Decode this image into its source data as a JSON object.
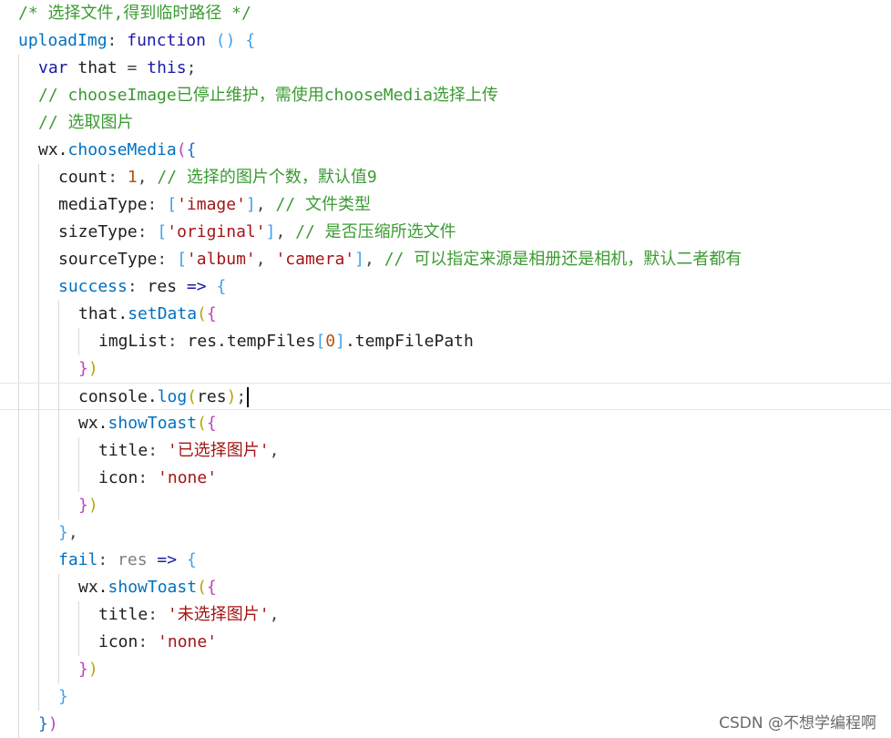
{
  "editor": {
    "lines": [
      {
        "indent": 0,
        "tokens": [
          [
            "comment",
            "/* 选择文件,得到临时路径 */"
          ]
        ]
      },
      {
        "indent": 0,
        "tokens": [
          [
            "propfn",
            "uploadImg"
          ],
          [
            "punct",
            ": "
          ],
          [
            "keyword",
            "function"
          ],
          [
            "plain",
            " "
          ],
          [
            "b3",
            "()"
          ],
          [
            "plain",
            " "
          ],
          [
            "b3",
            "{"
          ]
        ]
      },
      {
        "indent": 1,
        "tokens": [
          [
            "keyword",
            "var"
          ],
          [
            "plain",
            " that "
          ],
          [
            "punct",
            "= "
          ],
          [
            "keyword",
            "this"
          ],
          [
            "punct",
            ";"
          ]
        ]
      },
      {
        "indent": 1,
        "tokens": [
          [
            "comment",
            "// chooseImage已停止维护，需使用chooseMedia选择上传"
          ]
        ]
      },
      {
        "indent": 1,
        "tokens": [
          [
            "comment",
            "// 选取图片"
          ]
        ]
      },
      {
        "indent": 1,
        "tokens": [
          [
            "plain",
            "wx."
          ],
          [
            "propfn",
            "chooseMedia"
          ],
          [
            "b2",
            "("
          ],
          [
            "b1",
            "{"
          ]
        ]
      },
      {
        "indent": 2,
        "tokens": [
          [
            "prop",
            "count"
          ],
          [
            "punct",
            ": "
          ],
          [
            "num",
            "1"
          ],
          [
            "punct",
            ", "
          ],
          [
            "comment",
            "// 选择的图片个数，默认值9"
          ]
        ]
      },
      {
        "indent": 2,
        "tokens": [
          [
            "prop",
            "mediaType"
          ],
          [
            "punct",
            ": "
          ],
          [
            "b3",
            "["
          ],
          [
            "str",
            "'image'"
          ],
          [
            "b3",
            "]"
          ],
          [
            "punct",
            ", "
          ],
          [
            "comment",
            "// 文件类型"
          ]
        ]
      },
      {
        "indent": 2,
        "tokens": [
          [
            "prop",
            "sizeType"
          ],
          [
            "punct",
            ": "
          ],
          [
            "b3",
            "["
          ],
          [
            "str",
            "'original'"
          ],
          [
            "b3",
            "]"
          ],
          [
            "punct",
            ", "
          ],
          [
            "comment",
            "// 是否压缩所选文件"
          ]
        ]
      },
      {
        "indent": 2,
        "tokens": [
          [
            "prop",
            "sourceType"
          ],
          [
            "punct",
            ": "
          ],
          [
            "b3",
            "["
          ],
          [
            "str",
            "'album'"
          ],
          [
            "punct",
            ", "
          ],
          [
            "str",
            "'camera'"
          ],
          [
            "b3",
            "]"
          ],
          [
            "punct",
            ", "
          ],
          [
            "comment",
            "// 可以指定来源是相册还是相机，默认二者都有"
          ]
        ]
      },
      {
        "indent": 2,
        "tokens": [
          [
            "propfn",
            "success"
          ],
          [
            "punct",
            ": "
          ],
          [
            "plain",
            "res "
          ],
          [
            "keyword",
            "=>"
          ],
          [
            "plain",
            " "
          ],
          [
            "b3",
            "{"
          ]
        ]
      },
      {
        "indent": 3,
        "tokens": [
          [
            "plain",
            "that."
          ],
          [
            "propfn",
            "setData"
          ],
          [
            "b4",
            "("
          ],
          [
            "b2",
            "{"
          ]
        ]
      },
      {
        "indent": 4,
        "tokens": [
          [
            "prop",
            "imgList"
          ],
          [
            "punct",
            ": "
          ],
          [
            "plain",
            "res.tempFiles"
          ],
          [
            "b3",
            "["
          ],
          [
            "num",
            "0"
          ],
          [
            "b3",
            "]"
          ],
          [
            "plain",
            ".tempFilePath"
          ]
        ]
      },
      {
        "indent": 3,
        "tokens": [
          [
            "b2",
            "}"
          ],
          [
            "b4",
            ")"
          ]
        ]
      },
      {
        "indent": 3,
        "current": true,
        "tokens": [
          [
            "plain",
            "console."
          ],
          [
            "propfn",
            "log"
          ],
          [
            "b4",
            "("
          ],
          [
            "plain",
            "res"
          ],
          [
            "b4",
            ")"
          ],
          [
            "punct",
            ";"
          ]
        ]
      },
      {
        "indent": 3,
        "tokens": [
          [
            "plain",
            "wx."
          ],
          [
            "propfn",
            "showToast"
          ],
          [
            "b4",
            "("
          ],
          [
            "b2",
            "{"
          ]
        ]
      },
      {
        "indent": 4,
        "tokens": [
          [
            "prop",
            "title"
          ],
          [
            "punct",
            ": "
          ],
          [
            "str",
            "'已选择图片'"
          ],
          [
            "punct",
            ","
          ]
        ]
      },
      {
        "indent": 4,
        "tokens": [
          [
            "prop",
            "icon"
          ],
          [
            "punct",
            ": "
          ],
          [
            "str",
            "'none'"
          ]
        ]
      },
      {
        "indent": 3,
        "tokens": [
          [
            "b2",
            "}"
          ],
          [
            "b4",
            ")"
          ]
        ]
      },
      {
        "indent": 2,
        "tokens": [
          [
            "b3",
            "}"
          ],
          [
            "punct",
            ","
          ]
        ]
      },
      {
        "indent": 2,
        "tokens": [
          [
            "propfn",
            "fail"
          ],
          [
            "punct",
            ": "
          ],
          [
            "param",
            "res"
          ],
          [
            "plain",
            " "
          ],
          [
            "keyword",
            "=>"
          ],
          [
            "plain",
            " "
          ],
          [
            "b3",
            "{"
          ]
        ]
      },
      {
        "indent": 3,
        "tokens": [
          [
            "plain",
            "wx."
          ],
          [
            "propfn",
            "showToast"
          ],
          [
            "b4",
            "("
          ],
          [
            "b2",
            "{"
          ]
        ]
      },
      {
        "indent": 4,
        "tokens": [
          [
            "prop",
            "title"
          ],
          [
            "punct",
            ": "
          ],
          [
            "str",
            "'未选择图片'"
          ],
          [
            "punct",
            ","
          ]
        ]
      },
      {
        "indent": 4,
        "tokens": [
          [
            "prop",
            "icon"
          ],
          [
            "punct",
            ": "
          ],
          [
            "str",
            "'none'"
          ]
        ]
      },
      {
        "indent": 3,
        "tokens": [
          [
            "b2",
            "}"
          ],
          [
            "b4",
            ")"
          ]
        ]
      },
      {
        "indent": 2,
        "tokens": [
          [
            "b3",
            "}"
          ]
        ]
      },
      {
        "indent": 1,
        "tokens": [
          [
            "b1",
            "}"
          ],
          [
            "b2",
            ")"
          ]
        ]
      }
    ]
  },
  "watermark": "CSDN @不想学编程啊"
}
